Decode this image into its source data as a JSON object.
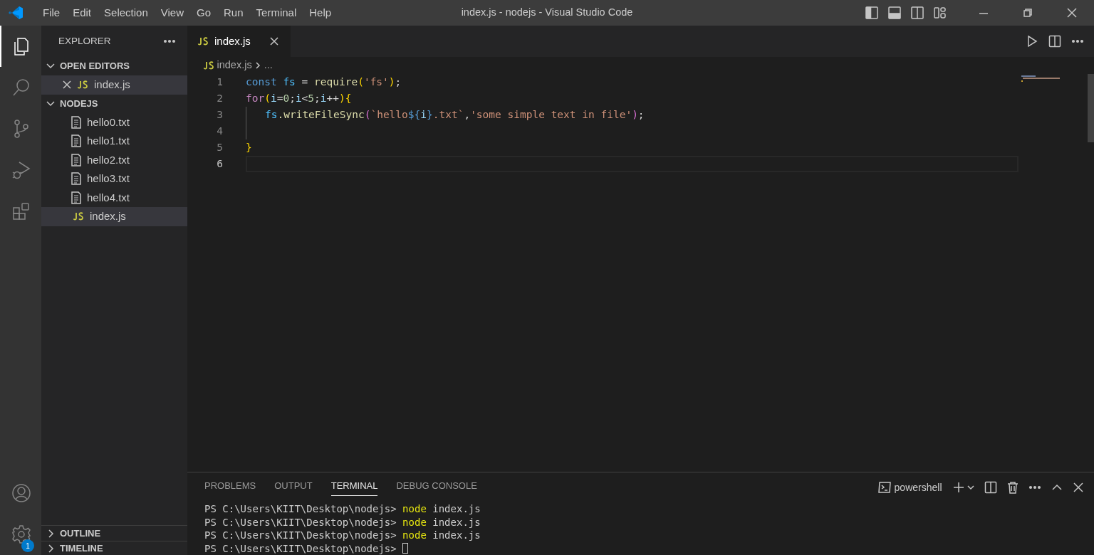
{
  "title_bar": {
    "menu": [
      "File",
      "Edit",
      "Selection",
      "View",
      "Go",
      "Run",
      "Terminal",
      "Help"
    ],
    "title": "index.js - nodejs - Visual Studio Code"
  },
  "activity_bar": {
    "items": [
      {
        "kind": "files",
        "selected": true
      },
      {
        "kind": "search",
        "selected": false
      },
      {
        "kind": "source-control",
        "selected": false
      },
      {
        "kind": "run-debug",
        "selected": false
      },
      {
        "kind": "extensions",
        "selected": false
      }
    ],
    "bottom": [
      {
        "kind": "account"
      },
      {
        "kind": "settings",
        "badge": "1"
      }
    ]
  },
  "sidebar": {
    "title": "EXPLORER",
    "sections": [
      {
        "label": "OPEN EDITORS",
        "expanded": true,
        "items": [
          {
            "label": "index.js",
            "kind": "js",
            "selected": true,
            "closable": true
          }
        ]
      },
      {
        "label": "NODEJS",
        "expanded": true,
        "items": [
          {
            "label": "hello0.txt",
            "kind": "text",
            "selected": false
          },
          {
            "label": "hello1.txt",
            "kind": "text",
            "selected": false
          },
          {
            "label": "hello2.txt",
            "kind": "text",
            "selected": false
          },
          {
            "label": "hello3.txt",
            "kind": "text",
            "selected": false
          },
          {
            "label": "hello4.txt",
            "kind": "text",
            "selected": false
          },
          {
            "label": "index.js",
            "kind": "js",
            "selected": true
          }
        ]
      }
    ],
    "bottom_sections": [
      {
        "label": "OUTLINE",
        "expanded": false
      },
      {
        "label": "TIMELINE",
        "expanded": false
      }
    ]
  },
  "tabs": [
    {
      "label": "index.js",
      "kind": "js",
      "selected": true
    }
  ],
  "breadcrumb": [
    "index.js",
    "..."
  ],
  "editor": {
    "lines": [
      {
        "number": "1",
        "current": false,
        "indent": false,
        "tokens": [
          {
            "t": "const ",
            "color": "#569cd6"
          },
          {
            "t": "fs",
            "color": "#4fc1ff"
          },
          {
            "t": " = ",
            "color": "#d4d4d4"
          },
          {
            "t": "require",
            "color": "#dcdcaa"
          },
          {
            "t": "(",
            "color": "#ffd700"
          },
          {
            "t": "'fs'",
            "color": "#ce9178"
          },
          {
            "t": ")",
            "color": "#ffd700"
          },
          {
            "t": ";",
            "color": "#d4d4d4"
          }
        ]
      },
      {
        "number": "2",
        "current": false,
        "indent": false,
        "tokens": [
          {
            "t": "for",
            "color": "#c586c0"
          },
          {
            "t": "(",
            "color": "#ffd700"
          },
          {
            "t": "i",
            "color": "#9cdcfe"
          },
          {
            "t": "=",
            "color": "#d4d4d4"
          },
          {
            "t": "0",
            "color": "#b5cea8"
          },
          {
            "t": ";",
            "color": "#d4d4d4"
          },
          {
            "t": "i",
            "color": "#9cdcfe"
          },
          {
            "t": "<",
            "color": "#d4d4d4"
          },
          {
            "t": "5",
            "color": "#b5cea8"
          },
          {
            "t": ";",
            "color": "#d4d4d4"
          },
          {
            "t": "i",
            "color": "#9cdcfe"
          },
          {
            "t": "++",
            "color": "#d4d4d4"
          },
          {
            "t": "){",
            "color": "#ffd700"
          }
        ]
      },
      {
        "number": "3",
        "current": false,
        "indent": true,
        "tokens": [
          {
            "t": "fs",
            "color": "#4fc1ff"
          },
          {
            "t": ".writeFileSync",
            "color": "#dcdcaa"
          },
          {
            "t": "(",
            "color": "#da70d6"
          },
          {
            "t": "`hello",
            "color": "#ce9178"
          },
          {
            "t": "${",
            "color": "#569cd6"
          },
          {
            "t": "i",
            "color": "#9cdcfe"
          },
          {
            "t": "}",
            "color": "#569cd6"
          },
          {
            "t": ".txt`",
            "color": "#ce9178"
          },
          {
            "t": ",",
            "color": "#d4d4d4"
          },
          {
            "t": "'some simple text in file'",
            "color": "#ce9178"
          },
          {
            "t": ")",
            "color": "#da70d6"
          },
          {
            "t": ";",
            "color": "#d4d4d4"
          }
        ]
      },
      {
        "number": "4",
        "current": false,
        "indent": true
      },
      {
        "number": "5",
        "current": false,
        "indent": false,
        "tokens": [
          {
            "t": "}",
            "color": "#ffd700"
          }
        ]
      },
      {
        "number": "6",
        "current": true,
        "indent": false
      }
    ]
  },
  "panel": {
    "tabs": [
      {
        "label": "PROBLEMS",
        "selected": false
      },
      {
        "label": "OUTPUT",
        "selected": false
      },
      {
        "label": "TERMINAL",
        "selected": true
      },
      {
        "label": "DEBUG CONSOLE",
        "selected": false
      }
    ],
    "terminal_profile": "powershell",
    "terminal_lines": [
      {
        "prompt": "PS C:\\Users\\KIIT\\Desktop\\nodejs>",
        "command": "node",
        "args": "index.js"
      },
      {
        "prompt": "PS C:\\Users\\KIIT\\Desktop\\nodejs>",
        "command": "node",
        "args": "index.js"
      },
      {
        "prompt": "PS C:\\Users\\KIIT\\Desktop\\nodejs>",
        "command": "node",
        "args": "index.js"
      },
      {
        "prompt": "PS C:\\Users\\KIIT\\Desktop\\nodejs>",
        "cursor": true
      }
    ]
  }
}
